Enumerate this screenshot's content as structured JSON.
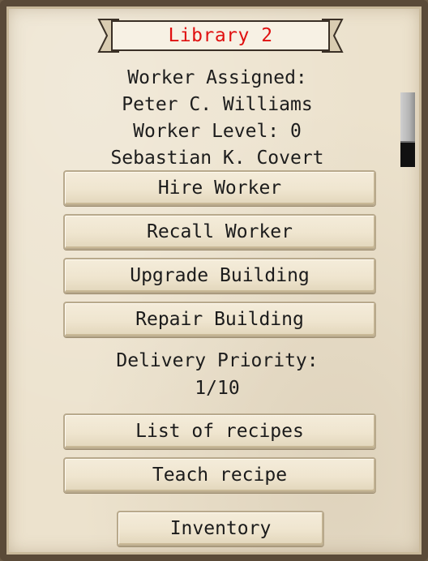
{
  "window": {
    "title": "Library 2"
  },
  "worker_info": {
    "assigned_label": "Worker Assigned:",
    "assigned_name": "Peter C. Williams",
    "level_label": "Worker Level: 0",
    "second_worker": "Sebastian K. Covert"
  },
  "buttons": {
    "hire": "Hire Worker",
    "recall": "Recall Worker",
    "upgrade": "Upgrade Building",
    "repair": "Repair Building",
    "recipes": "List of recipes",
    "teach": "Teach recipe",
    "inventory": "Inventory"
  },
  "delivery": {
    "label": "Delivery Priority:",
    "value": "1/10"
  },
  "scroll": {
    "position_fraction": 0.0,
    "visible_fraction": 0.67
  },
  "colors": {
    "title": "#e01010",
    "parchment": "#ece2cd",
    "text": "#1d1d1d"
  }
}
